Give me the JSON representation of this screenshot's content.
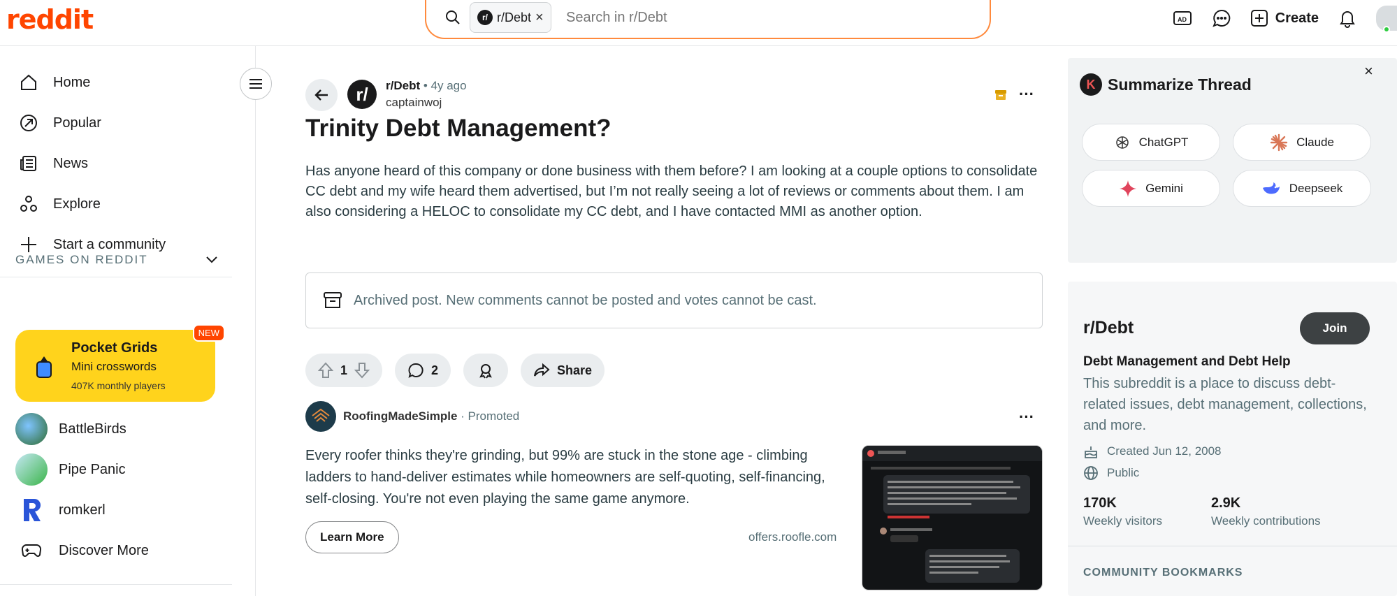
{
  "header": {
    "logo": "reddit",
    "search_chip": "r/Debt",
    "search_chip_icon": "r/",
    "search_placeholder": "Search in r/Debt",
    "create_label": "Create"
  },
  "sidebar": {
    "nav": [
      {
        "label": "Home",
        "icon": "home-icon"
      },
      {
        "label": "Popular",
        "icon": "popular-icon"
      },
      {
        "label": "News",
        "icon": "news-icon"
      },
      {
        "label": "Explore",
        "icon": "explore-icon"
      },
      {
        "label": "Start a community",
        "icon": "plus-icon"
      }
    ],
    "games_heading": "GAMES ON REDDIT",
    "featured_game": {
      "title": "Pocket Grids",
      "subtitle": "Mini crosswords",
      "players": "407K monthly players",
      "badge": "NEW"
    },
    "games": [
      {
        "label": "BattleBirds"
      },
      {
        "label": "Pipe Panic"
      },
      {
        "label": "romkerl"
      },
      {
        "label": "Discover More"
      }
    ]
  },
  "post": {
    "subreddit": "r/Debt",
    "time_ago": "4y ago",
    "author": "captainwoj",
    "title": "Trinity Debt Management?",
    "body": "Has anyone heard of this company or done business with them before? I am looking at a couple options to consolidate CC debt and my wife heard them advertised, but I’m not really seeing a lot of reviews or comments about them. I am also considering a HELOC to consolidate my CC debt, and I have contacted MMI as another option.",
    "archived_notice": "Archived post. New comments cannot be posted and votes cannot be cast.",
    "votes": "1",
    "comments": "2",
    "share_label": "Share"
  },
  "ad": {
    "advertiser": "RoofingMadeSimple",
    "promoted_label": "Promoted",
    "text": "Every roofer thinks they're grinding, but 99% are stuck in the stone age - climbing ladders to hand-deliver estimates while homeowners are self-quoting, self-financing, self-closing. You're not even playing the same game anymore.",
    "cta": "Learn More",
    "url": "offers.roofle.com"
  },
  "summarize": {
    "logo_letter": "K",
    "title": "Summarize Thread",
    "close": "×",
    "buttons": [
      {
        "label": "ChatGPT",
        "icon": "chatgpt-icon"
      },
      {
        "label": "Claude",
        "icon": "claude-icon"
      },
      {
        "label": "Gemini",
        "icon": "gemini-icon"
      },
      {
        "label": "Deepseek",
        "icon": "deepseek-icon"
      }
    ]
  },
  "community": {
    "name": "r/Debt",
    "join_label": "Join",
    "headline": "Debt Management and Debt Help",
    "description": "This subreddit is a place to discuss debt-related issues, debt management, collections, and more.",
    "created": "Created Jun 12, 2008",
    "visibility": "Public",
    "weekly_visitors_value": "170K",
    "weekly_visitors_label": "Weekly visitors",
    "weekly_contrib_value": "2.9K",
    "weekly_contrib_label": "Weekly contributions",
    "bookmarks_heading": "COMMUNITY BOOKMARKS"
  },
  "colors": {
    "brand": "#ff4500",
    "pocket_grids_bg": "#ffd31c",
    "join_bg": "#3d4143"
  }
}
